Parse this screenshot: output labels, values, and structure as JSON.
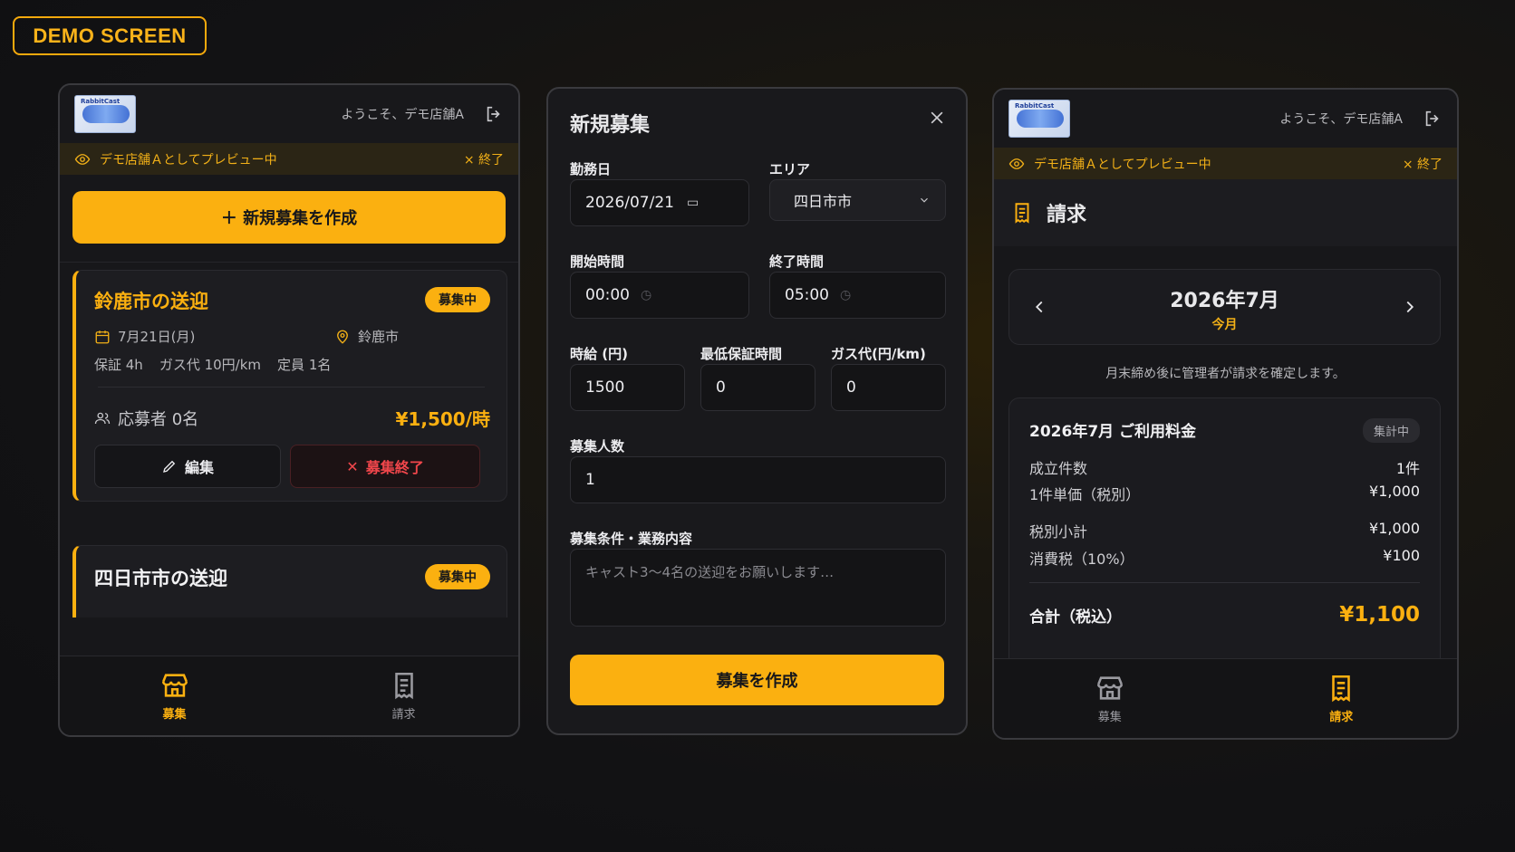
{
  "demo_label": "DEMO SCREEN",
  "common": {
    "welcome": "ようこそ、デモ店舗A",
    "preview": "デモ店舗Ａとしてプレビュー中",
    "preview_end": "× 終了",
    "nav": {
      "recruit": "募集",
      "billing": "請求"
    },
    "accent_color": "#fbb010"
  },
  "listing": {
    "create_button": "＋ 新規募集を作成",
    "jobs": [
      {
        "title": "鈴鹿市の送迎",
        "status": "募集中",
        "date": "7月21日(月)",
        "area": "鈴鹿市",
        "guarantee": "保証 4h",
        "gas": "ガス代 10円/km",
        "capacity": "定員 1名",
        "applicants": "応募者 0名",
        "wage": "¥1,500/時",
        "edit": "編集",
        "close": "募集終了"
      },
      {
        "title": "四日市市の送迎",
        "status": "募集中"
      }
    ]
  },
  "form": {
    "title": "新規募集",
    "work_date_label": "勤務日",
    "work_date": "2026/07/21",
    "area_label": "エリア",
    "area": "四日市市",
    "start_label": "開始時間",
    "start": "00:00",
    "end_label": "終了時間",
    "end": "05:00",
    "wage_label": "時給 (円)",
    "wage": "1500",
    "min_hours_label": "最低保証時間",
    "min_hours": "0",
    "gas_label": "ガス代(円/km)",
    "gas": "0",
    "count_label": "募集人数",
    "count": "1",
    "conditions_label": "募集条件・業務内容",
    "conditions_placeholder": "キャスト3〜4名の送迎をお願いします…",
    "submit": "募集を作成"
  },
  "billing": {
    "title": "請求",
    "month": "2026年7月",
    "current": "今月",
    "note": "月末締め後に管理者が請求を確定します。",
    "summary_title": "2026年7月 ご利用料金",
    "summary_status": "集計中",
    "rows": [
      {
        "label": "成立件数",
        "value": "1件"
      },
      {
        "label": "1件単価（税別）",
        "value": "¥1,000"
      },
      {
        "label": "税別小計",
        "value": "¥1,000"
      },
      {
        "label": "消費税（10%）",
        "value": "¥100"
      }
    ],
    "total_label": "合計（税込）",
    "total": "¥1,100"
  }
}
